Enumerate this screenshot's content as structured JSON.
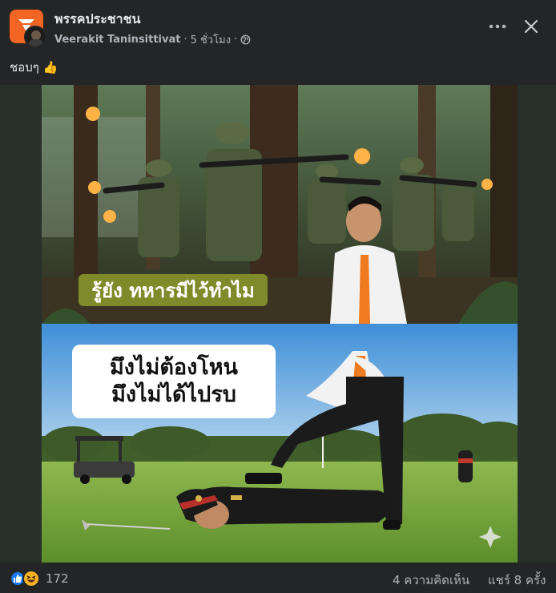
{
  "post": {
    "page_name": "พรรคประชาชน",
    "author": "Veerakit Taninsittivat",
    "separator": "·",
    "time": "5 ชั่วโมง",
    "privacy_icon": "globe-icon",
    "text": "ชอบๆ 👍"
  },
  "image": {
    "caption_top": "รู้ยัง ทหารมีไว้ทำไม",
    "caption_bottom_line1": "มึงไม่ต้องโหน",
    "caption_bottom_line2": "มึงไม่ได้ไปรบ"
  },
  "footer": {
    "reaction_count": "172",
    "comments": "4 ความคิดเห็น",
    "shares": "แชร์ 8 ครั้ง"
  },
  "colors": {
    "brand": "#f26522",
    "background": "#242526",
    "like_blue": "#1877f2",
    "caption_olive": "#7f8a2a"
  }
}
